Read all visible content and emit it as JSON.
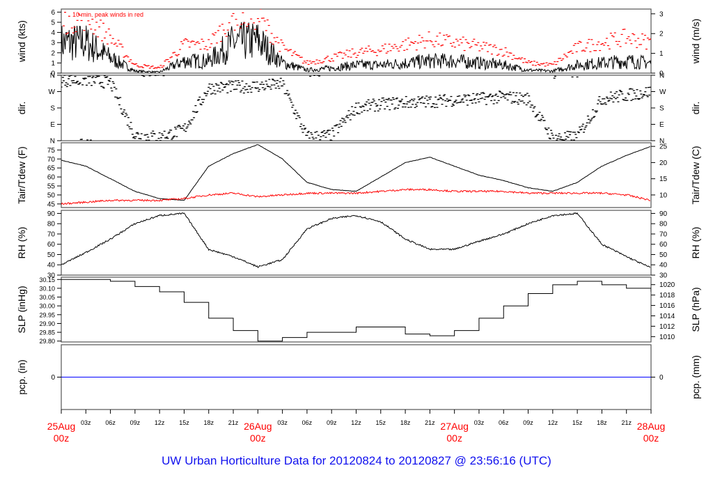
{
  "title": "UW Urban Horticulture Data for 20120824  to  20120827 @ 23:56:16  (UTC)",
  "colors": {
    "main": "#000000",
    "peak": "#ff0000",
    "dew": "#ff0000",
    "pcp": "#0000ff",
    "title": "#1010ee",
    "day_labels": "#ff0000"
  },
  "chart_data": [
    {
      "type": "line",
      "id": "wind",
      "ylabel": "wind (kts)",
      "ylabel_right": "wind (m/s)",
      "ylim": [
        0,
        6.3
      ],
      "yticks": [
        0,
        1,
        2,
        3,
        4,
        5,
        6
      ],
      "yticks_right": [
        0,
        1,
        2,
        3
      ],
      "right_factor": 0.5144,
      "annotation": "10 min. peak winds in red",
      "x_hours": [
        0,
        3,
        6,
        9,
        12,
        15,
        18,
        21,
        24,
        27,
        30,
        33,
        36,
        39,
        42,
        45,
        48,
        51,
        54,
        57,
        60,
        63,
        66,
        69,
        72
      ],
      "series": [
        {
          "name": "wind",
          "values": [
            3,
            3,
            1.5,
            0.2,
            0.1,
            1.2,
            1.2,
            3,
            3.2,
            1,
            0.3,
            0.5,
            0.8,
            0.8,
            1,
            1.2,
            1.2,
            1,
            0.8,
            0.3,
            0.2,
            0.8,
            1,
            1.2,
            1
          ]
        },
        {
          "name": "peak",
          "values": [
            5,
            5.5,
            3.5,
            0.8,
            0.5,
            2.8,
            2.8,
            5.5,
            5.6,
            2.5,
            1,
            1.5,
            2,
            2.3,
            2.8,
            3.3,
            3,
            2.6,
            2.2,
            1,
            0.8,
            2.5,
            3,
            3.5,
            3
          ]
        }
      ]
    },
    {
      "type": "scatter",
      "id": "dir",
      "ylabel": "dir.",
      "ylabel_right": "dir.",
      "ylim": [
        0,
        360
      ],
      "ytick_labels": [
        "N",
        "E",
        "S",
        "W",
        "N"
      ],
      "ytick_values": [
        0,
        90,
        180,
        270,
        360
      ],
      "x_hours": [
        0,
        3,
        6,
        9,
        12,
        15,
        18,
        21,
        24,
        27,
        30,
        33,
        36,
        39,
        42,
        45,
        48,
        51,
        54,
        57,
        60,
        63,
        66,
        69,
        72
      ],
      "series": [
        {
          "name": "direction",
          "values": [
            330,
            335,
            320,
            30,
            20,
            60,
            290,
            295,
            300,
            310,
            20,
            30,
            180,
            200,
            210,
            215,
            225,
            230,
            240,
            230,
            15,
            20,
            230,
            250,
            270
          ]
        }
      ]
    },
    {
      "type": "line",
      "id": "temp",
      "ylabel": "Tair/Tdew (F)",
      "ylabel_right": "Tair/Tdew (C)",
      "ylim": [
        43,
        79
      ],
      "yticks": [
        45,
        50,
        55,
        60,
        65,
        70,
        75
      ],
      "yticks_right": [
        10,
        15,
        20,
        25
      ],
      "x_hours": [
        0,
        3,
        6,
        9,
        12,
        15,
        18,
        21,
        24,
        27,
        30,
        33,
        36,
        39,
        42,
        45,
        48,
        51,
        54,
        57,
        60,
        63,
        66,
        69,
        72
      ],
      "series": [
        {
          "name": "Tair",
          "values": [
            69.3,
            66,
            59,
            52,
            48,
            47,
            66,
            73,
            78,
            70,
            57,
            53,
            52,
            60,
            68,
            71,
            66,
            61,
            58,
            54,
            52,
            57,
            66,
            72,
            77
          ]
        },
        {
          "name": "Tdew",
          "values": [
            45,
            46,
            47,
            47,
            47,
            48,
            50,
            51,
            49,
            50,
            51,
            51,
            51,
            52,
            53,
            53,
            52,
            52,
            52,
            51,
            51,
            51,
            51,
            50,
            47
          ]
        }
      ]
    },
    {
      "type": "line",
      "id": "rh",
      "ylabel": "RH (%)",
      "ylabel_right": "RH (%)",
      "ylim": [
        30,
        93
      ],
      "yticks": [
        30,
        40,
        50,
        60,
        70,
        80,
        90
      ],
      "x_hours": [
        0,
        3,
        6,
        9,
        12,
        15,
        18,
        21,
        24,
        27,
        30,
        33,
        36,
        39,
        42,
        45,
        48,
        51,
        54,
        57,
        60,
        63,
        66,
        69,
        72
      ],
      "series": [
        {
          "name": "RH",
          "values": [
            40,
            52,
            65,
            80,
            88,
            90,
            55,
            48,
            38,
            45,
            75,
            85,
            88,
            82,
            65,
            55,
            55,
            63,
            70,
            80,
            88,
            90,
            60,
            48,
            37
          ]
        }
      ]
    },
    {
      "type": "line",
      "id": "slp",
      "ylabel": "SLP (inHg)",
      "ylabel_right": "SLP (hPa)",
      "ylim": [
        29.795,
        30.163
      ],
      "yticks": [
        "29.80",
        "29.85",
        "29.90",
        "29.95",
        "30.00",
        "30.05",
        "30.10",
        "30.15"
      ],
      "yticks_right": [
        1010,
        1012,
        1014,
        1016,
        1018,
        1020
      ],
      "x_hours": [
        0,
        3,
        6,
        9,
        12,
        15,
        18,
        21,
        24,
        27,
        30,
        33,
        36,
        39,
        42,
        45,
        48,
        51,
        54,
        57,
        60,
        63,
        66,
        69,
        72
      ],
      "series": [
        {
          "name": "SLP",
          "values": [
            30.15,
            30.15,
            30.14,
            30.11,
            30.08,
            30.02,
            29.93,
            29.86,
            29.8,
            29.82,
            29.85,
            29.85,
            29.88,
            29.88,
            29.84,
            29.83,
            29.86,
            29.93,
            30.0,
            30.07,
            30.12,
            30.14,
            30.12,
            30.1,
            30.08
          ]
        }
      ]
    },
    {
      "type": "line",
      "id": "pcp",
      "ylabel": "pcp. (in)",
      "ylabel_right": "pcp. (mm)",
      "ylim": [
        -1,
        1
      ],
      "yticks": [
        0
      ],
      "yticks_right": [
        0
      ],
      "x_hours": [
        0,
        72
      ],
      "series": [
        {
          "name": "pcp",
          "values": [
            0,
            0
          ]
        }
      ]
    }
  ],
  "xaxis": {
    "hour_ticks": [
      "03z",
      "06z",
      "09z",
      "12z",
      "15z",
      "18z",
      "21z"
    ],
    "days": [
      {
        "day": "25Aug",
        "hour": "00z"
      },
      {
        "day": "26Aug",
        "hour": "00z"
      },
      {
        "day": "27Aug",
        "hour": "00z"
      },
      {
        "day": "28Aug",
        "hour": "00z"
      }
    ]
  }
}
